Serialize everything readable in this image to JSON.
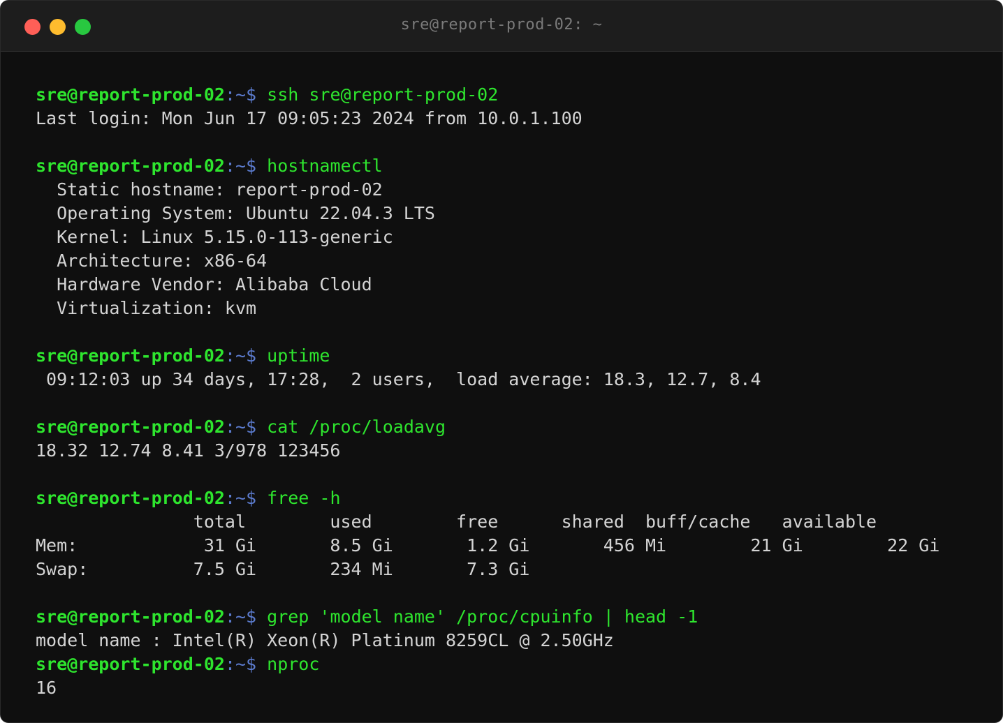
{
  "window": {
    "title": "sre@report-prod-02: ~"
  },
  "prompt": {
    "user_host": "sre@report-prod-02",
    "path": ":~",
    "symbol": "$ "
  },
  "lines": [
    {
      "type": "cmd",
      "text": "ssh sre@report-prod-02"
    },
    {
      "type": "out",
      "text": "Last login: Mon Jun 17 09:05:23 2024 from 10.0.1.100"
    },
    {
      "type": "blank"
    },
    {
      "type": "cmd",
      "text": "hostnamectl"
    },
    {
      "type": "out",
      "text": "  Static hostname: report-prod-02"
    },
    {
      "type": "out",
      "text": "  Operating System: Ubuntu 22.04.3 LTS"
    },
    {
      "type": "out",
      "text": "  Kernel: Linux 5.15.0-113-generic"
    },
    {
      "type": "out",
      "text": "  Architecture: x86-64"
    },
    {
      "type": "out",
      "text": "  Hardware Vendor: Alibaba Cloud"
    },
    {
      "type": "out",
      "text": "  Virtualization: kvm"
    },
    {
      "type": "blank"
    },
    {
      "type": "cmd",
      "text": "uptime"
    },
    {
      "type": "out",
      "text": " 09:12:03 up 34 days, 17:28,  2 users,  load average: 18.3, 12.7, 8.4"
    },
    {
      "type": "blank"
    },
    {
      "type": "cmd",
      "text": "cat /proc/loadavg"
    },
    {
      "type": "out",
      "text": "18.32 12.74 8.41 3/978 123456"
    },
    {
      "type": "blank"
    },
    {
      "type": "cmd",
      "text": "free -h"
    },
    {
      "type": "out",
      "text": "               total        used        free      shared  buff/cache   available"
    },
    {
      "type": "out",
      "text": "Mem:            31 Gi       8.5 Gi       1.2 Gi       456 Mi        21 Gi        22 Gi"
    },
    {
      "type": "out",
      "text": "Swap:          7.5 Gi       234 Mi       7.3 Gi"
    },
    {
      "type": "blank"
    },
    {
      "type": "cmd",
      "text": "grep 'model name' /proc/cpuinfo | head -1"
    },
    {
      "type": "out",
      "text": "model name : Intel(R) Xeon(R) Platinum 8259CL @ 2.50GHz"
    },
    {
      "type": "cmd",
      "text": "nproc"
    },
    {
      "type": "out",
      "text": "16"
    }
  ],
  "colors": {
    "prompt_green": "#2ee52e",
    "path_blue": "#5c7ccf",
    "output_gray": "#d4d4d4",
    "background": "#0f0f0f"
  }
}
